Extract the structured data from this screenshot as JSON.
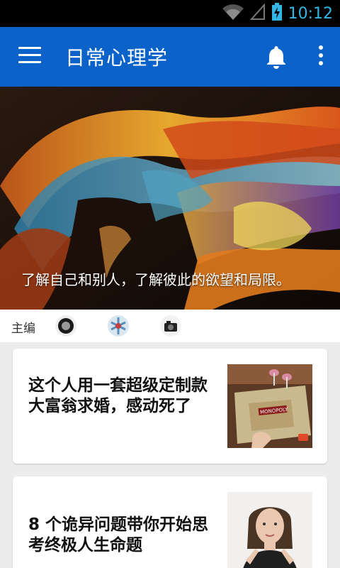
{
  "status_bar": {
    "time": "10:12",
    "icons": [
      "wifi-icon",
      "signal-icon",
      "battery-charging-icon"
    ],
    "color": "#33b5e5"
  },
  "app_bar": {
    "title": "日常心理学",
    "menu_icon": "hamburger-menu-icon",
    "notification_icon": "bell-icon",
    "overflow_icon": "more-vertical-icon",
    "color": "#0b63c9"
  },
  "hero": {
    "caption": "了解自己和别人，了解彼此的欲望和局限。"
  },
  "editors": {
    "label": "主编",
    "avatars": [
      "editor-avatar-1",
      "editor-avatar-2",
      "editor-avatar-3"
    ]
  },
  "articles": [
    {
      "title": "这个人用一套超级定制款大富翁求婚，感动死了",
      "thumb_text": "MONOPOLY"
    },
    {
      "title": "8 个诡异问题带你开始思考终极人生命题"
    }
  ]
}
